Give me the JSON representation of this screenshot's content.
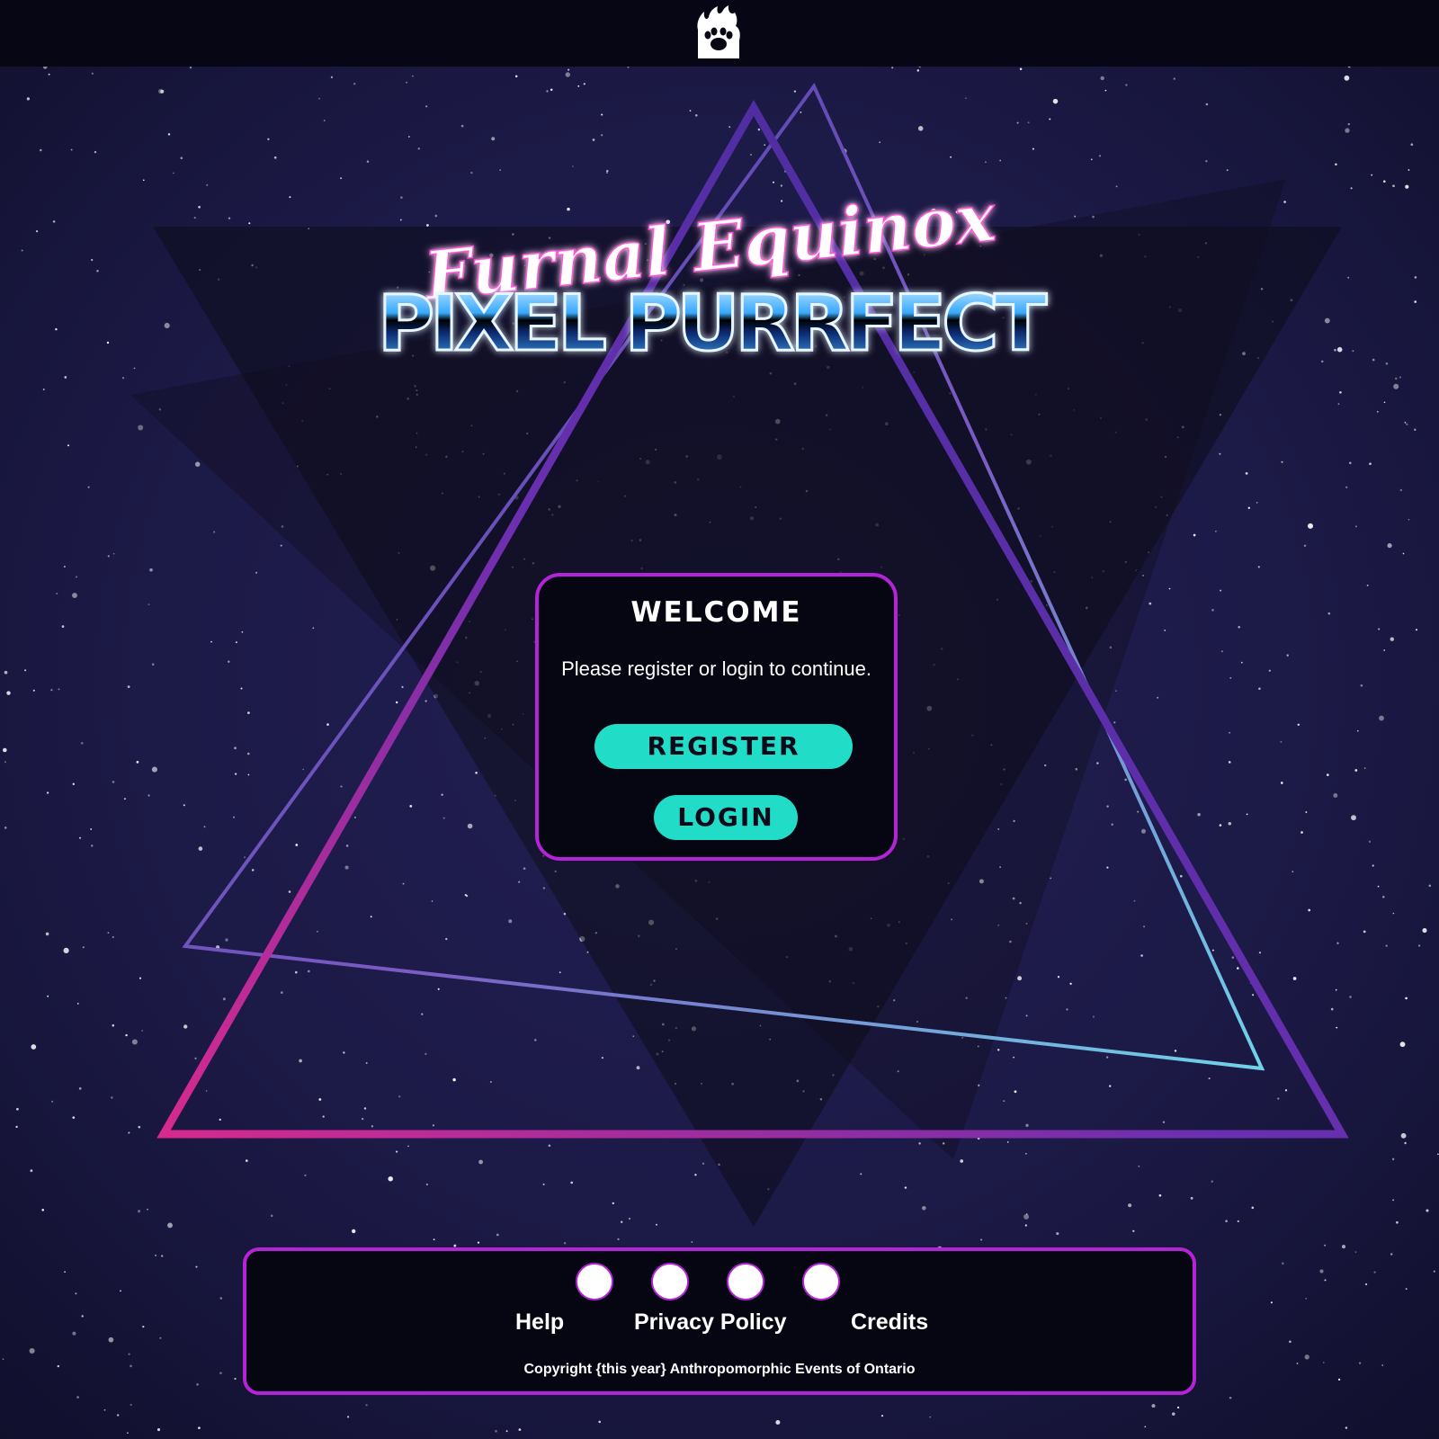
{
  "header": {
    "logo_icon": "paw-flame-logo-icon"
  },
  "hero": {
    "script_title": "Furnal Equinox",
    "main_title": "PIXEL PURRFECT"
  },
  "welcome_card": {
    "title": "WELCOME",
    "message": "Please register or login to continue.",
    "register_label": "REGISTER",
    "login_label": "LOGIN"
  },
  "footer": {
    "social_icons": [
      "social-icon-1",
      "social-icon-2",
      "social-icon-3",
      "social-icon-4"
    ],
    "links": [
      "Help",
      "Privacy Policy",
      "Credits"
    ],
    "copyright": "Copyright {this year} Anthropomorphic Events of Ontario"
  },
  "colors": {
    "topbar": "#070614",
    "space": "#1a1840",
    "card_border": "#b324d6",
    "button": "#21ddc8",
    "button_text": "#0a0a1a"
  }
}
